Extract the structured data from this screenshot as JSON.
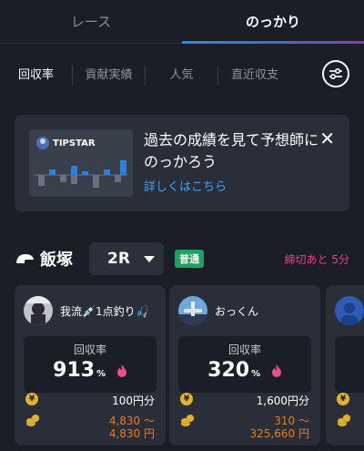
{
  "tabs": [
    {
      "label": "レース",
      "active": false
    },
    {
      "label": "のっかり",
      "active": true
    }
  ],
  "filters": [
    {
      "label": "回収率",
      "active": true
    },
    {
      "label": "貢献実績",
      "active": false
    },
    {
      "label": "人気",
      "active": false
    },
    {
      "label": "直近収支",
      "active": false
    }
  ],
  "filter_icon": "sliders-icon",
  "promo": {
    "logo_text": "TIPSTAR",
    "title": "過去の成績を見て予想師にのっかろう",
    "link": "詳しくはこちら",
    "close_icon": "close-icon"
  },
  "race": {
    "venue": "飯塚",
    "race_number": "2R",
    "badge": "普通",
    "deadline": "締切あと 5分"
  },
  "cards": [
    {
      "name": "我流💉1点釣り🎣",
      "stat_label": "回収率",
      "stat_value": "913",
      "stat_unit": "%",
      "bet_amount": "100円分",
      "payout_line1": "4,830 〜",
      "payout_line2": "4,830 円"
    },
    {
      "name": "おっくん",
      "stat_label": "回収率",
      "stat_value": "320",
      "stat_unit": "%",
      "bet_amount": "1,600円分",
      "payout_line1": "310 〜",
      "payout_line2": "325,660 円"
    }
  ],
  "colors": {
    "background": "#1b1e26",
    "card": "#2a2e38",
    "accent_blue": "#3ea2ff",
    "deadline_pink": "#e8428c",
    "badge_green": "#1ba35f",
    "payout_orange": "#ef7b1c"
  }
}
